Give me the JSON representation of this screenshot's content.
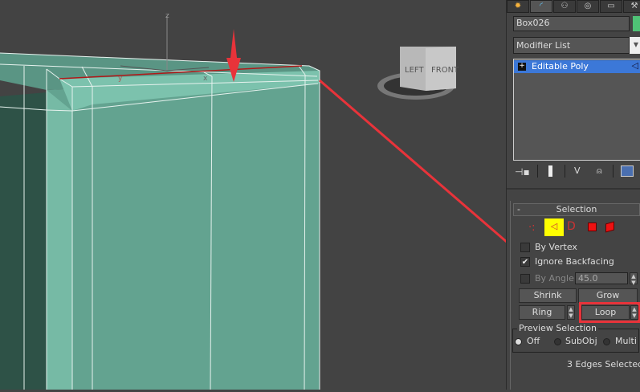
{
  "viewport": {
    "axis_z": "z",
    "axis_x": "x",
    "axis_y": "y",
    "viewcube": {
      "left": "LEFT",
      "front": "FRONT"
    }
  },
  "panel": {
    "tabs": [
      "create",
      "modify",
      "hierarchy",
      "motion",
      "display",
      "utilities"
    ],
    "object_name": "Box026",
    "object_color": "#4fc276",
    "modifier_list": "Modifier List",
    "stack": [
      {
        "label": "Editable Poly",
        "expand": "+"
      }
    ],
    "stack_tools": [
      "pin-stack",
      "show-end-result",
      "make-unique",
      "remove-modifier",
      "configure-modifier-sets"
    ],
    "selection": {
      "title": "Selection",
      "collapse": "-",
      "by_vertex": "By Vertex",
      "ignore_backfacing": "Ignore Backfacing",
      "by_angle": "By Angle:",
      "angle_value": "45.0",
      "shrink": "Shrink",
      "grow": "Grow",
      "ring": "Ring",
      "loop": "Loop",
      "preview_title": "Preview Selection",
      "preview_options": [
        "Off",
        "SubObj",
        "Multi"
      ],
      "status": "3 Edges Selected",
      "checked": {
        "by_vertex": false,
        "ignore_backfacing": true,
        "by_angle": false
      },
      "check_mark": "✔"
    }
  },
  "colors": {
    "highlight": "#3c78d8",
    "annotation": "#e8333a",
    "active_mode": "#ffff00"
  }
}
